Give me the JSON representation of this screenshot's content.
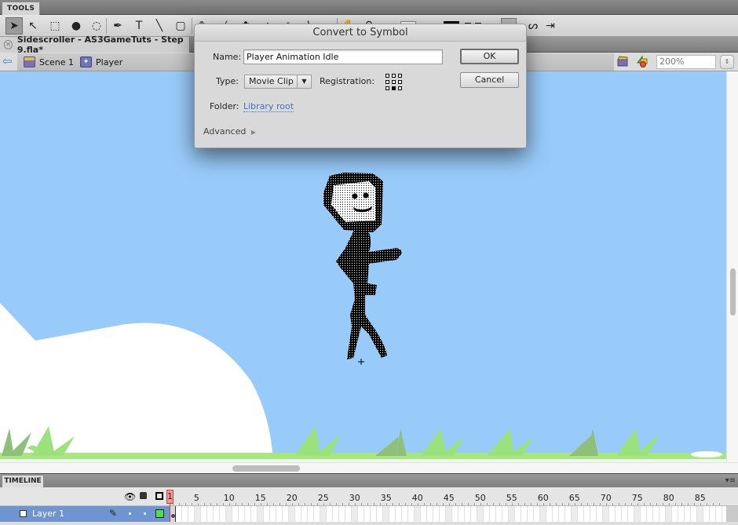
{
  "tools_panel": {
    "tab_label": "TOOLS",
    "tools": [
      {
        "name": "selection-tool",
        "glyph": "➤",
        "active": true
      },
      {
        "name": "subselection-tool",
        "glyph": "↖",
        "active": false
      },
      {
        "name": "free-transform-tool",
        "glyph": "⬚",
        "active": false
      },
      {
        "name": "3d-rotation-tool",
        "glyph": "●",
        "active": false
      },
      {
        "name": "lasso-tool",
        "glyph": "◌",
        "active": false
      },
      {
        "name": "pen-tool",
        "glyph": "✒",
        "active": false
      },
      {
        "name": "text-tool",
        "glyph": "T",
        "active": false
      },
      {
        "name": "line-tool",
        "glyph": "╲",
        "active": false
      },
      {
        "name": "rectangle-tool",
        "glyph": "▢",
        "active": false
      },
      {
        "name": "pencil-tool",
        "glyph": "✎",
        "active": false
      },
      {
        "name": "brush-tool",
        "glyph": "⁄",
        "active": false
      },
      {
        "name": "deco-tool",
        "glyph": "✿",
        "active": false
      },
      {
        "name": "bone-tool",
        "glyph": "⌂",
        "active": false
      },
      {
        "name": "paint-bucket-tool",
        "glyph": "◈",
        "active": false
      },
      {
        "name": "eyedropper-tool",
        "glyph": "⌇",
        "active": false
      },
      {
        "name": "eraser-tool",
        "glyph": "▭",
        "active": false
      },
      {
        "name": "hand-tool",
        "glyph": "✋",
        "active": false
      },
      {
        "name": "zoom-tool",
        "glyph": "⚲",
        "active": false
      }
    ]
  },
  "document": {
    "tab_title": "Sidescroller - AS3GameTuts - Step 9.fla*"
  },
  "editbar": {
    "breadcrumbs": [
      {
        "label": "Scene 1",
        "icon": "scene-icon"
      },
      {
        "label": "Player",
        "icon": "movie-clip-icon"
      }
    ],
    "zoom_value": "200%"
  },
  "dialog": {
    "title": "Convert to Symbol",
    "name_label": "Name:",
    "name_value": "Player Animation Idle",
    "type_label": "Type:",
    "type_value": "Movie Clip",
    "registration_label": "Registration:",
    "registration_selected": "bottom-center",
    "folder_label": "Folder:",
    "folder_value": "Library root",
    "advanced_label": "Advanced",
    "ok_label": "OK",
    "cancel_label": "Cancel"
  },
  "timeline": {
    "tab_label": "TIMELINE",
    "frame_numbers": [
      "1",
      "5",
      "10",
      "15",
      "20",
      "25",
      "30",
      "35",
      "40",
      "45",
      "50",
      "55",
      "60",
      "65",
      "70",
      "75",
      "80",
      "85"
    ],
    "current_frame": "1",
    "layers": [
      {
        "name": "Layer 1",
        "color": "#4ddf4d"
      }
    ]
  },
  "colors": {
    "stage_bg": "#99cbfa",
    "layer_selected": "#6f95d0",
    "playhead": "#f19a9a",
    "link": "#3b74c4"
  }
}
